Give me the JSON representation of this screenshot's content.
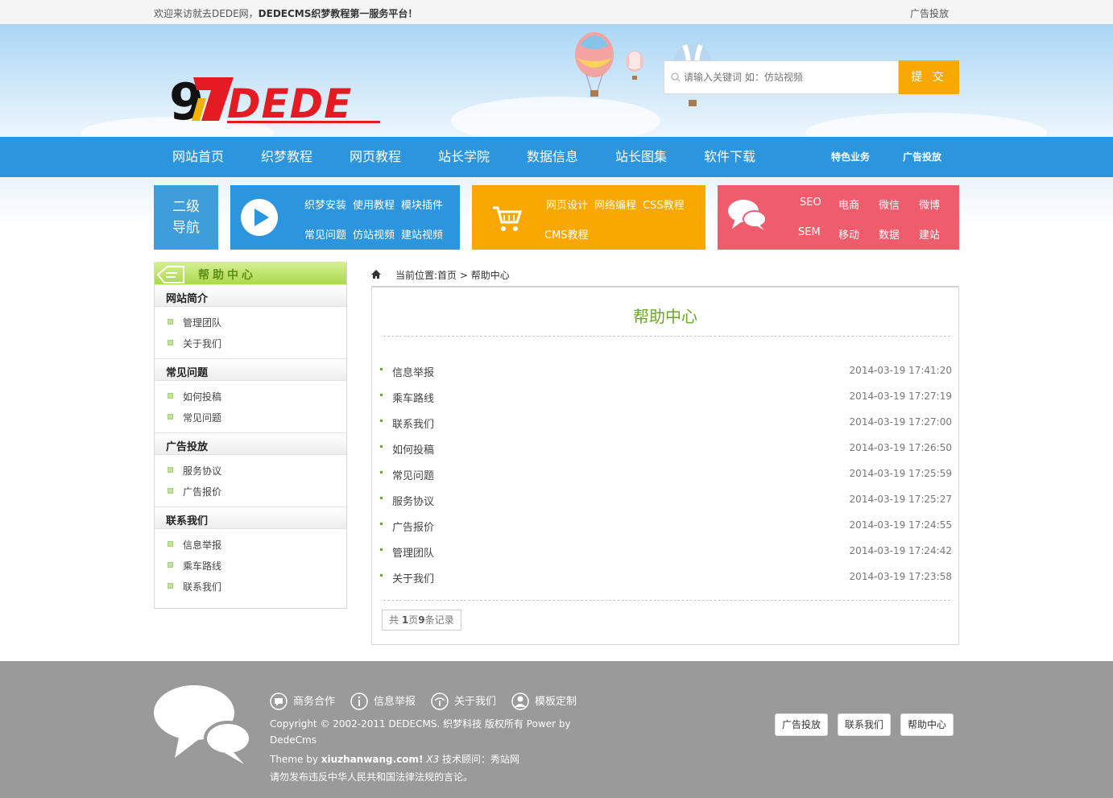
{
  "topbar": {
    "welcome_prefix": "欢迎来访就去DEDE网，",
    "welcome_bold": "DEDECMS织梦教程第一服务平台！",
    "ad_link": "广告投放"
  },
  "search": {
    "placeholder": "请输入关键词 如：仿站视频",
    "button": "提 交"
  },
  "nav": {
    "items": [
      "网站首页",
      "织梦教程",
      "网页教程",
      "站长学院",
      "数据信息",
      "站长图集",
      "软件下载"
    ],
    "right": [
      "特色业务",
      "广告投放"
    ]
  },
  "tiles": {
    "sub": {
      "line1": "二级",
      "line2": "导航"
    },
    "blue": {
      "links": [
        "织梦安装",
        "使用教程",
        "模块插件",
        "常见问题",
        "仿站视频",
        "建站视频"
      ]
    },
    "orange": {
      "links": [
        "网页设计",
        "网络编程",
        "CSS教程",
        "CMS教程"
      ]
    },
    "red": {
      "links": [
        "SEO",
        "电商",
        "微信",
        "微博",
        "SEM",
        "移动",
        "数据",
        "建站"
      ]
    }
  },
  "sidebar": {
    "title": "帮助中心",
    "sections": [
      {
        "title": "网站简介",
        "items": [
          "管理团队",
          "关于我们"
        ]
      },
      {
        "title": "常见问题",
        "items": [
          "如何投稿",
          "常见问题"
        ]
      },
      {
        "title": "广告投放",
        "items": [
          "服务协议",
          "广告报价"
        ]
      },
      {
        "title": "联系我们",
        "items": [
          "信息举报",
          "乘车路线",
          "联系我们"
        ]
      }
    ]
  },
  "breadcrumb": {
    "label": "当前位置:",
    "home": "首页",
    "sep": ">",
    "current": "帮助中心"
  },
  "content": {
    "title": "帮助中心",
    "articles": [
      {
        "title": "信息举报",
        "date": "2014-03-19 17:41:20"
      },
      {
        "title": "乘车路线",
        "date": "2014-03-19 17:27:19"
      },
      {
        "title": "联系我们",
        "date": "2014-03-19 17:27:00"
      },
      {
        "title": "如何投稿",
        "date": "2014-03-19 17:26:50"
      },
      {
        "title": "常见问题",
        "date": "2014-03-19 17:25:59"
      },
      {
        "title": "服务协议",
        "date": "2014-03-19 17:25:27"
      },
      {
        "title": "广告报价",
        "date": "2014-03-19 17:24:55"
      },
      {
        "title": "管理团队",
        "date": "2014-03-19 17:24:42"
      },
      {
        "title": "关于我们",
        "date": "2014-03-19 17:23:58"
      }
    ],
    "pager": {
      "prefix": "共 ",
      "pages": "1",
      "mid": "页",
      "count": "9",
      "suffix": "条记录"
    }
  },
  "footer": {
    "links": [
      "商务合作",
      "信息举报",
      "关于我们",
      "模板定制"
    ],
    "link_icons": [
      "chat-icon",
      "info-icon",
      "help-icon",
      "user-icon"
    ],
    "copyright_line1": "Copyright © 2002-2011 DEDECMS. 织梦科技 版权所有 Power by",
    "copyright_line2": "DedeCms",
    "theme_prefix": "Theme by ",
    "theme_site": "xiuzhanwang.com!",
    "theme_x3": " X3 ",
    "theme_suffix": "技术顾问：秀站网",
    "notice": "请勿发布违反中华人民共和国法律法规的言论。",
    "buttons": [
      "广告投放",
      "联系我们",
      "帮助中心"
    ]
  },
  "colors": {
    "nav_blue": "#2b95dd",
    "orange": "#f8a800",
    "red": "#ef5d6c",
    "green_title": "#6aa72b",
    "footer_gray": "#9a9a9a"
  }
}
